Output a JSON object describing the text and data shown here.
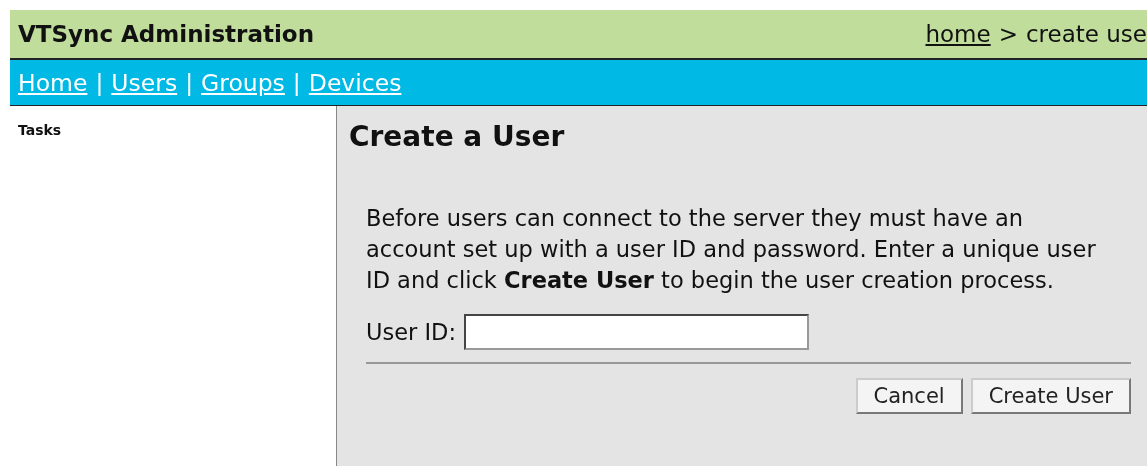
{
  "header": {
    "title": "VTSync Administration",
    "breadcrumb": {
      "link": "home",
      "separator": ">",
      "current": "create use"
    }
  },
  "nav": {
    "separator": "|",
    "links": [
      "Home",
      "Users",
      "Groups",
      "Devices"
    ]
  },
  "sidebar": {
    "title": "Tasks"
  },
  "main": {
    "title": "Create a User",
    "description": "Before users can connect to the server they must have an account set up with a user ID and password. Enter a unique user ID and click **Create User** to begin the user creation process.",
    "field": {
      "label": "User ID:"
    },
    "buttons": [
      "Cancel",
      "Create User"
    ]
  }
}
